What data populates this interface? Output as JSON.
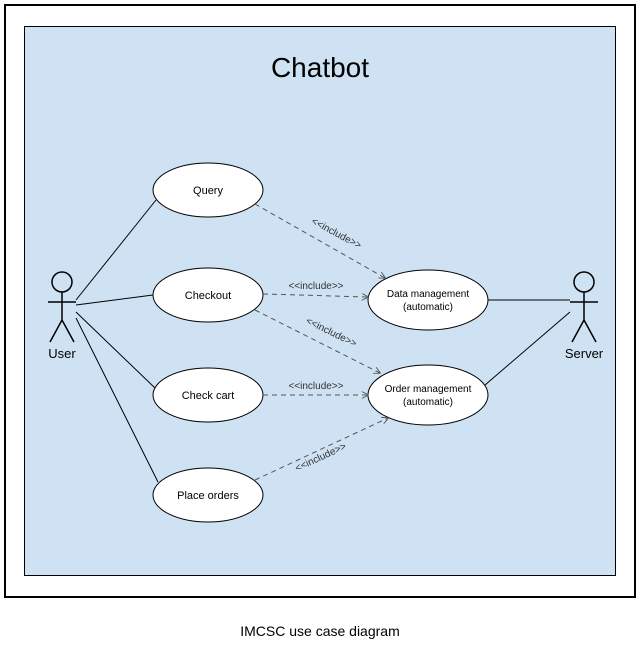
{
  "diagram": {
    "title": "Chatbot",
    "caption": "IMCSC use case diagram",
    "actors": {
      "user": "User",
      "server": "Server"
    },
    "usecases": {
      "query": "Query",
      "checkout": "Checkout",
      "check_cart": "Check cart",
      "place_orders": "Place orders",
      "data_mgmt_l1": "Data management",
      "data_mgmt_l2": "(automatic)",
      "order_mgmt_l1": "Order management",
      "order_mgmt_l2": "(automatic)"
    },
    "relations": {
      "query_to_data": "<<include>>",
      "checkout_to_data": "<<include>>",
      "checkout_to_order": "<<include>>",
      "checkcart_to_order": "<<include>>",
      "placeorders_to_order": "<<include>>"
    }
  }
}
